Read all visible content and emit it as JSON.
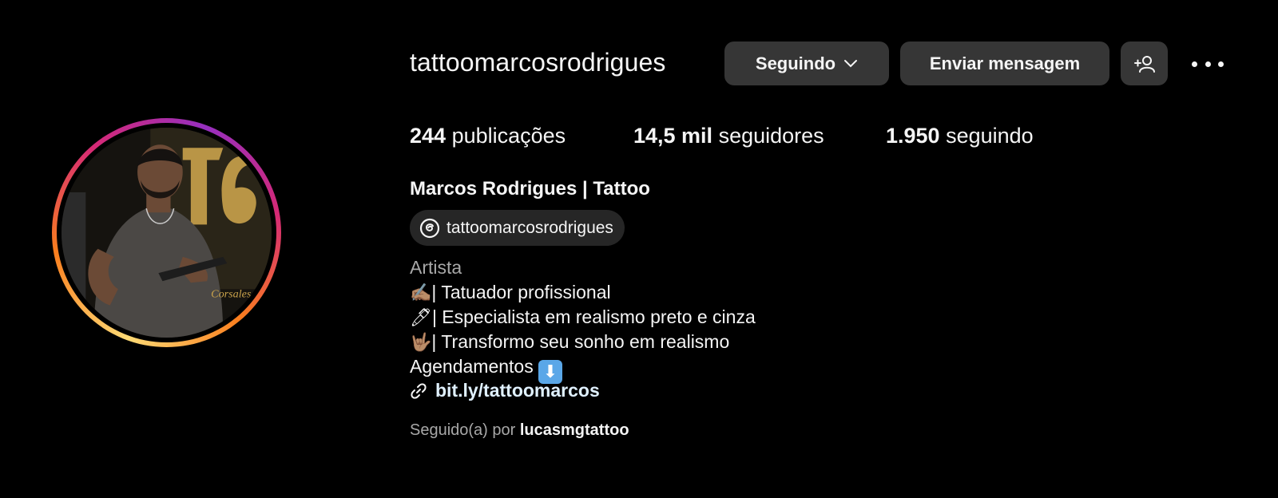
{
  "profile": {
    "username": "tattoomarcosrodrigues",
    "full_name": "Marcos Rodrigues | Tattoo",
    "threads_handle": "tattoomarcosrodrigues",
    "category": "Artista",
    "bio": {
      "line1_emoji": "✍🏽",
      "line1_text": "| Tatuador profissional",
      "line2_emoji": "🖊",
      "line2_text": "| Especialista em realismo preto e cinza",
      "line3_emoji": "🤟🏽",
      "line3_text": "| Transformo seu sonho em realismo",
      "line4_text": "Agendamentos",
      "line4_emoji": "⬇"
    },
    "link": "bit.ly/tattoomarcos",
    "followed_by_label": "Seguido(a) por",
    "followed_by_user": "lucasmgtattoo"
  },
  "stats": {
    "posts_count": "244",
    "posts_label": "publicações",
    "followers_count": "14,5 mil",
    "followers_label": "seguidores",
    "following_count": "1.950",
    "following_label": "seguindo"
  },
  "actions": {
    "follow_label": "Seguindo",
    "message_label": "Enviar mensagem"
  },
  "icons": {
    "chevron": "chevron-down-icon",
    "add_user": "add-user-icon",
    "more": "more-options-icon",
    "threads": "threads-icon",
    "link": "link-icon"
  },
  "colors": {
    "background": "#000000",
    "button_bg": "#363636",
    "text_primary": "#f5f5f5",
    "text_secondary": "#a8a8a8",
    "link_color": "#e0f1ff"
  }
}
